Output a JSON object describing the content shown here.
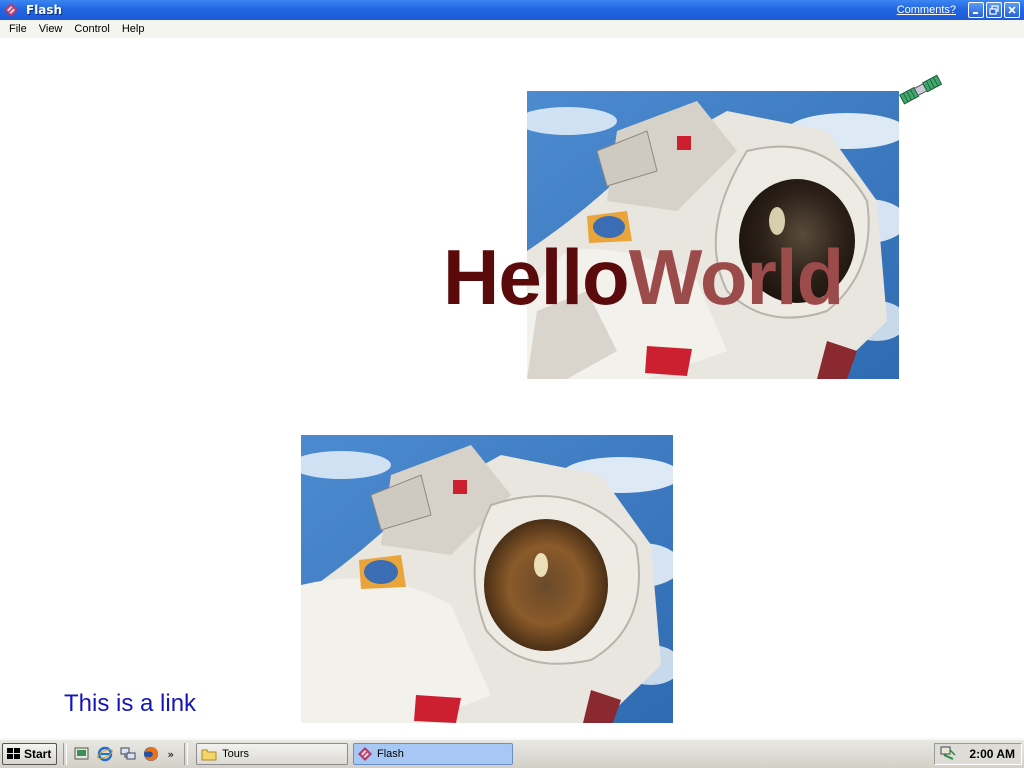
{
  "window": {
    "title": "Flash",
    "comments_link": "Comments?",
    "icon": "flash-app-icon",
    "buttons": {
      "minimize": "minimize-icon",
      "restore": "restore-icon",
      "close": "close-icon"
    }
  },
  "menu": {
    "items": [
      "File",
      "View",
      "Control",
      "Help"
    ]
  },
  "stage": {
    "hello_word1": "Hello",
    "hello_word2": "World",
    "link_text": "This is a link",
    "colors": {
      "hello": "#5a0a0a",
      "world": "#9c4b4b",
      "link": "#1616b8"
    }
  },
  "taskbar": {
    "start_label": "Start",
    "quick_launch": [
      "show-desktop-icon",
      "internet-explorer-icon",
      "network-icon",
      "firefox-icon"
    ],
    "chevron": "»",
    "tasks": [
      {
        "label": "Tours",
        "icon": "folder-icon"
      },
      {
        "label": "Flash",
        "icon": "flash-app-icon",
        "active": true
      }
    ],
    "clock": "2:00 AM"
  }
}
